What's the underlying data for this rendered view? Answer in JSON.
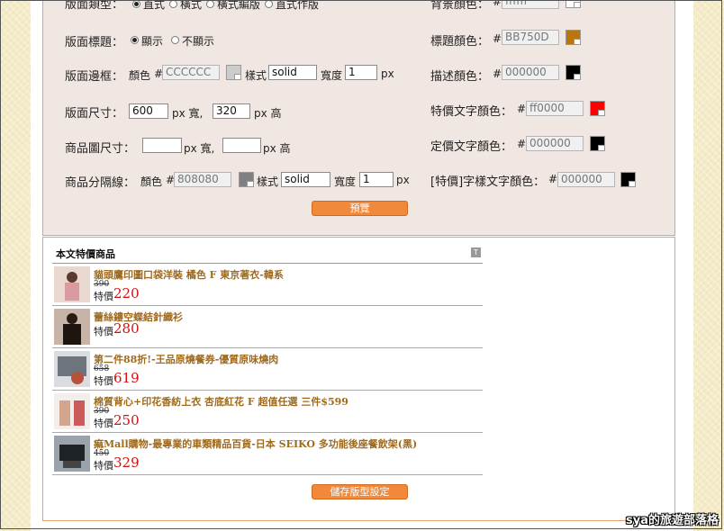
{
  "settings": {
    "layout_type": {
      "label": "版面類型：",
      "options": [
        "直式",
        "橫式",
        "橫式編版",
        "直式作版"
      ],
      "selected": 0
    },
    "bg_color": {
      "label": "背景顏色：",
      "hash": "#",
      "value": "ffffff"
    },
    "show_title": {
      "label": "版面標題：",
      "options": [
        "顯示",
        "不顯示"
      ],
      "selected": 0
    },
    "title_color": {
      "label": "標題顏色：",
      "hash": "#",
      "value": "BB750D",
      "swatch": "#BB750D"
    },
    "border": {
      "label": "版面邊框：",
      "color_label": "顏色",
      "hash": "#",
      "color_value": "CCCCCC",
      "swatch": "#CCCCCC",
      "style_label": "樣式",
      "style_value": "solid",
      "width_label": "寬度",
      "width_value": "1",
      "unit": "px"
    },
    "desc_color": {
      "label": "描述顏色：",
      "hash": "#",
      "value": "000000",
      "swatch": "#000000"
    },
    "size": {
      "label": "版面尺寸：",
      "width": "600",
      "w_unit": "px 寬,",
      "height": "320",
      "h_unit": "px 高"
    },
    "special_text_color": {
      "label": "特價文字顏色：",
      "hash": "#",
      "value": "ff0000",
      "swatch": "#ff0000"
    },
    "image_size": {
      "label": "商品圖尺寸：",
      "width": "",
      "w_unit": "px 寬,",
      "height": "",
      "h_unit": "px 高"
    },
    "fixed_text_color": {
      "label": "定價文字顏色：",
      "hash": "#",
      "value": "000000",
      "swatch": "#000000"
    },
    "divider": {
      "label": "商品分隔線：",
      "color_label": "顏色",
      "hash": "#",
      "color_value": "808080",
      "swatch": "#808080",
      "style_label": "樣式",
      "style_value": "solid",
      "width_label": "寬度",
      "width_value": "1",
      "unit": "px"
    },
    "special_word_color": {
      "label": "[特價]字樣文字顏色：",
      "hash": "#",
      "value": "000000",
      "swatch": "#000000"
    },
    "preview_button": "預覽"
  },
  "preview": {
    "title": "本文特價商品",
    "t_icon": "T",
    "special_label": "特價",
    "items": [
      {
        "name": "貓頭鷹印圖口袋洋裝 橘色 F 東京著衣-韓系",
        "orig": "390",
        "price": "220",
        "thumb": "#c9a89a"
      },
      {
        "name": "蕾絲鏤空蝶結針織衫",
        "orig": "",
        "price": "280",
        "thumb": "#3b2a24"
      },
      {
        "name": "第二件88折!-王品原燒餐券-優質原味燒肉",
        "orig": "658",
        "price": "619",
        "thumb": "#8a8f96"
      },
      {
        "name": "棉質背心+印花香紡上衣 杏底紅花 F 超值任選 三件$599",
        "orig": "390",
        "price": "250",
        "thumb": "#d8c6b6"
      },
      {
        "name": "痲Mall購物-最專業的車類精品百貨-日本 SEIKO 多功能後座餐飲架(黑)",
        "orig": "450",
        "price": "329",
        "thumb": "#3a3f44"
      }
    ]
  },
  "save_button": "儲存版型設定",
  "watermark": "sya的旅遊部落格"
}
